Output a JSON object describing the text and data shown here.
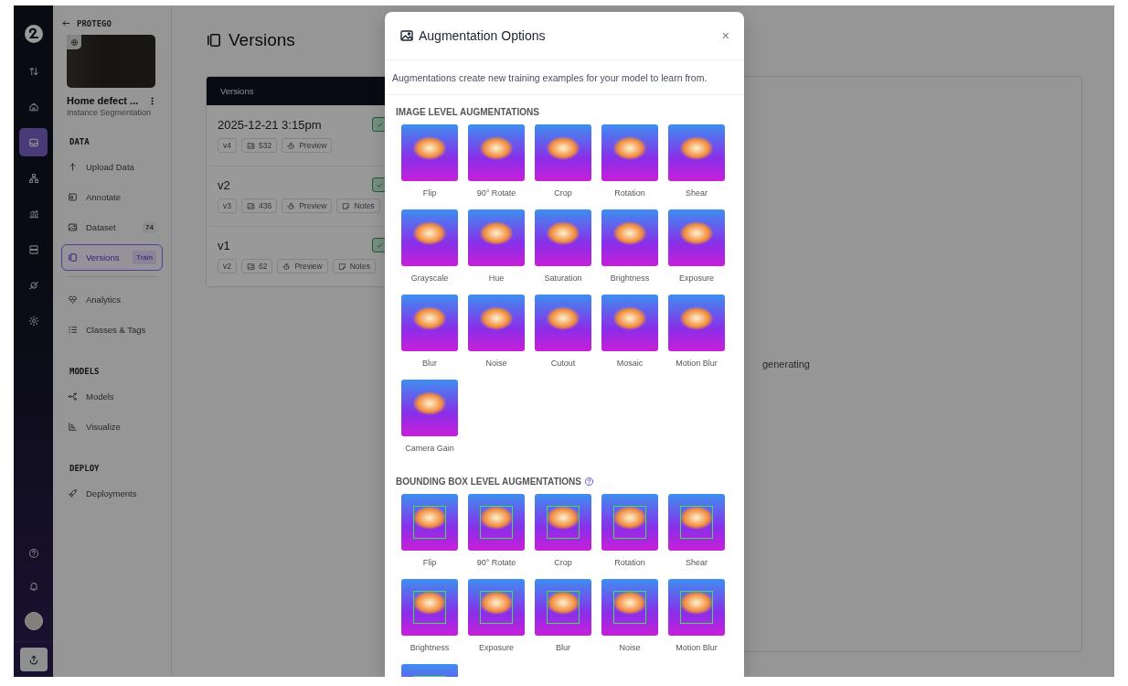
{
  "rail": {
    "items": [
      {
        "selected": false
      },
      {
        "selected": false
      },
      {
        "selected": true
      },
      {
        "selected": false
      },
      {
        "selected": false
      },
      {
        "selected": false
      },
      {
        "selected": false
      },
      {
        "selected": false
      }
    ]
  },
  "sidebar": {
    "back_label": "PROTEGO",
    "project_name": "Home defect ...",
    "project_type": "Instance Segmentation",
    "sections": [
      {
        "heading": "DATA",
        "items": [
          {
            "label": "Upload Data",
            "selected": false
          },
          {
            "label": "Annotate",
            "selected": false
          },
          {
            "label": "Dataset",
            "count": "74",
            "selected": false
          },
          {
            "label": "Versions",
            "badge": "Train",
            "selected": true
          }
        ]
      },
      {
        "items": [
          {
            "label": "Analytics",
            "selected": false
          },
          {
            "label": "Classes & Tags",
            "selected": false
          }
        ]
      },
      {
        "heading": "MODELS",
        "items": [
          {
            "label": "Models",
            "selected": false
          },
          {
            "label": "Visualize",
            "selected": false
          }
        ]
      },
      {
        "heading": "DEPLOY",
        "items": [
          {
            "label": "Deployments",
            "selected": false
          }
        ]
      }
    ]
  },
  "main": {
    "title": "Versions",
    "list_header": "Versions",
    "versions": [
      {
        "name": "2025-12-21 3:15pm",
        "tag": "v4",
        "images": "532",
        "preview": "Preview",
        "checked": true
      },
      {
        "name": "v2",
        "tag": "v3",
        "images": "436",
        "preview": "Preview",
        "notes": "Notes",
        "checked": true
      },
      {
        "name": "v1",
        "tag": "v2",
        "images": "62",
        "preview": "Preview",
        "notes": "Notes",
        "checked": true
      }
    ],
    "status_text": "generating"
  },
  "modal": {
    "title": "Augmentation Options",
    "close": "×",
    "description": "Augmentations create new training examples for your model to learn from.",
    "sections": [
      {
        "heading": "IMAGE LEVEL AUGMENTATIONS",
        "kind": "image",
        "help": false,
        "items": [
          {
            "label": "Flip"
          },
          {
            "label": "90° Rotate"
          },
          {
            "label": "Crop"
          },
          {
            "label": "Rotation"
          },
          {
            "label": "Shear"
          },
          {
            "label": "Grayscale"
          },
          {
            "label": "Hue"
          },
          {
            "label": "Saturation"
          },
          {
            "label": "Brightness"
          },
          {
            "label": "Exposure"
          },
          {
            "label": "Blur"
          },
          {
            "label": "Noise"
          },
          {
            "label": "Cutout"
          },
          {
            "label": "Mosaic"
          },
          {
            "label": "Motion Blur"
          },
          {
            "label": "Camera Gain"
          }
        ]
      },
      {
        "heading": "BOUNDING BOX LEVEL AUGMENTATIONS",
        "kind": "bbox",
        "help": true,
        "items": [
          {
            "label": "Flip"
          },
          {
            "label": "90° Rotate"
          },
          {
            "label": "Crop"
          },
          {
            "label": "Rotation"
          },
          {
            "label": "Shear"
          },
          {
            "label": "Brightness"
          },
          {
            "label": "Exposure"
          },
          {
            "label": "Blur"
          },
          {
            "label": "Noise"
          },
          {
            "label": "Motion Blur"
          }
        ],
        "more_below": true
      }
    ]
  }
}
